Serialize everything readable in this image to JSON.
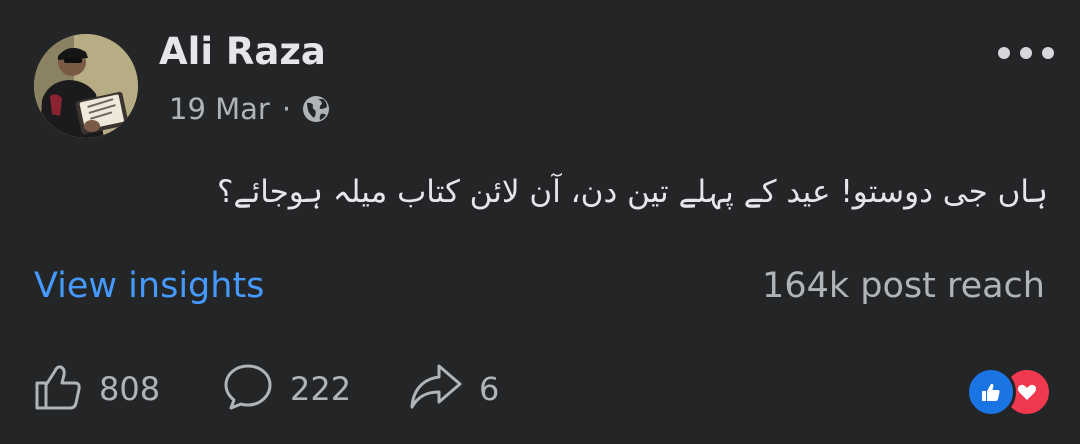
{
  "post": {
    "author": "Ali Raza",
    "date": "19 Mar",
    "separator": "·",
    "privacy_icon": "globe-icon",
    "text": "ہاں جی دوستو! عید کے پہلے تین دن، آن لائن کتاب میلہ ہوجائے؟",
    "menu_icon": "more-horizontal-icon"
  },
  "insights": {
    "link_label": "View insights",
    "reach_text": "164k post reach"
  },
  "actions": {
    "like_count": "808",
    "comment_count": "222",
    "share_count": "6"
  },
  "reactions": [
    "like-reaction-icon",
    "love-reaction-icon"
  ],
  "colors": {
    "background": "#242526",
    "link": "#4599ff",
    "secondary_text": "#b0b3b8",
    "like_blue": "#1b74e4",
    "love_red": "#f0384f"
  }
}
